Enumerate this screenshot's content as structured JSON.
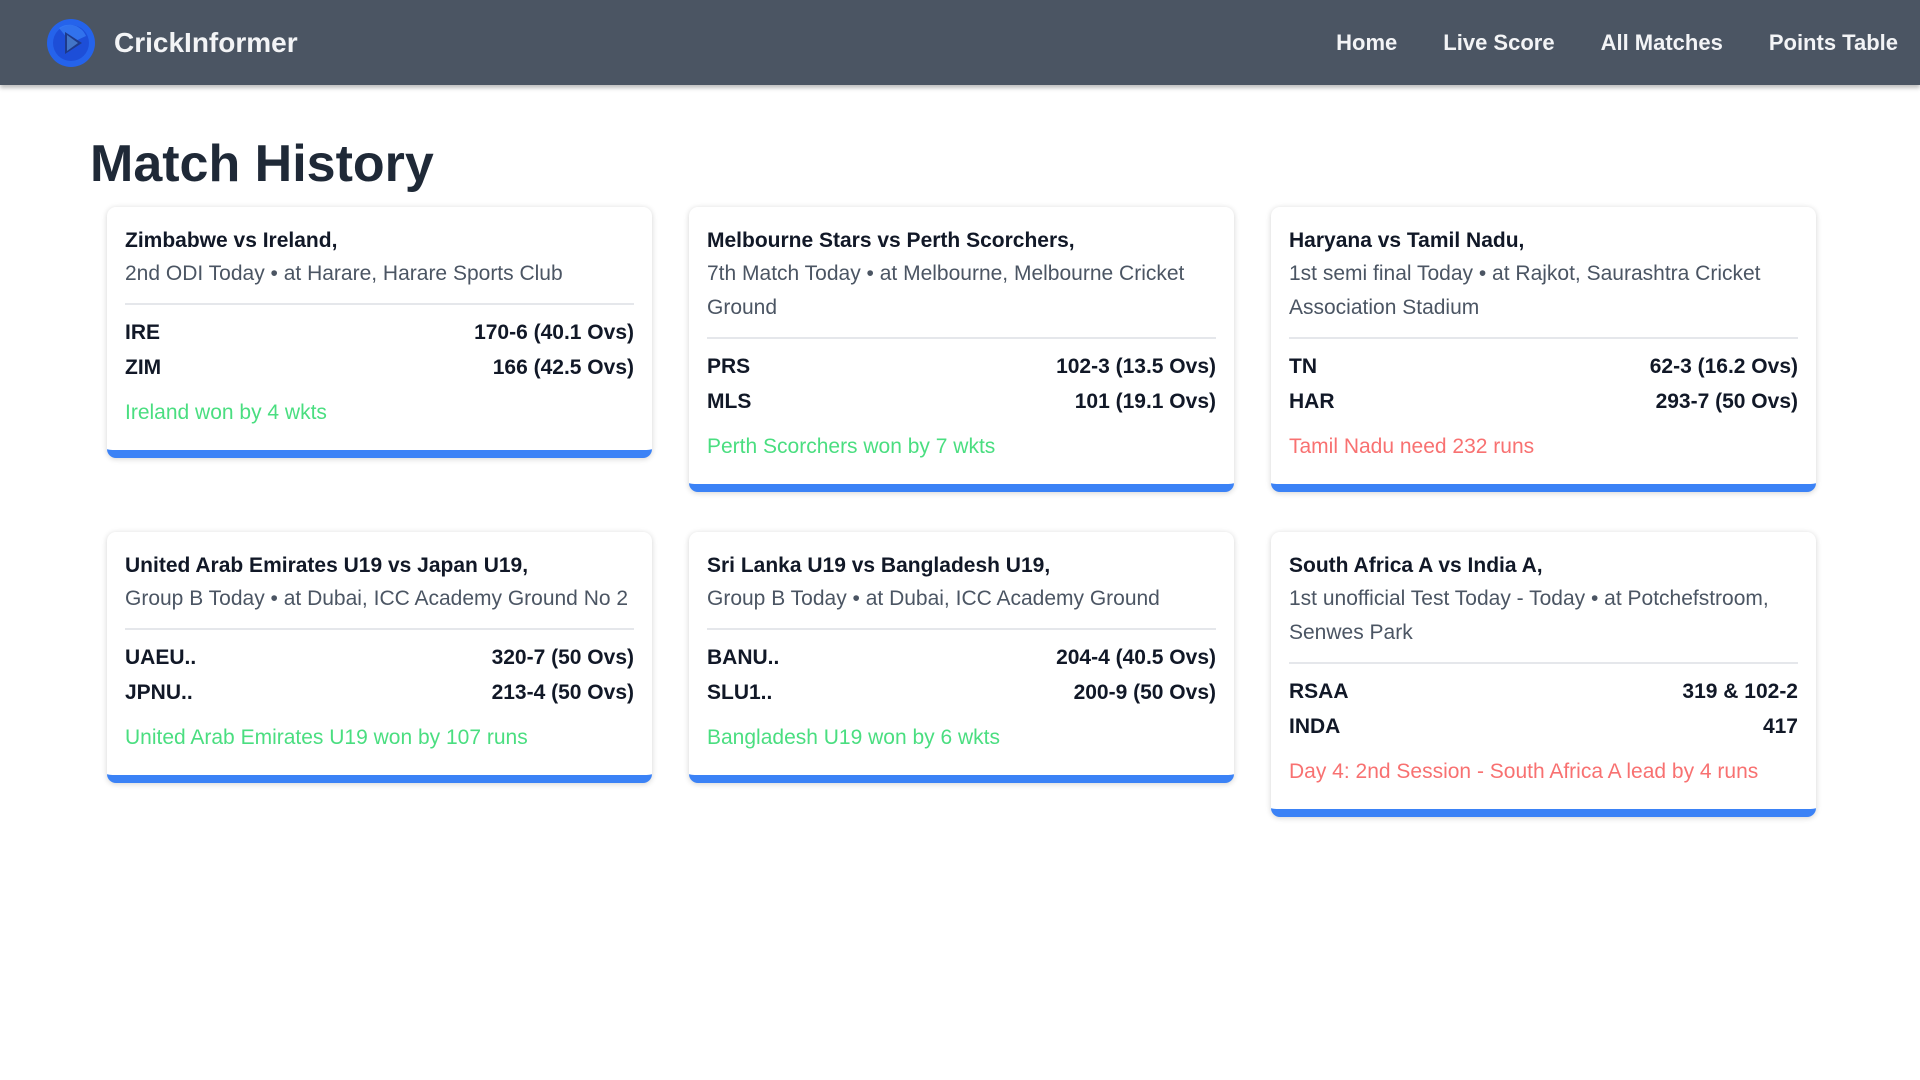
{
  "app": {
    "brand": "CrickInformer",
    "nav": [
      {
        "label": "Home"
      },
      {
        "label": "Live Score"
      },
      {
        "label": "All Matches"
      },
      {
        "label": "Points Table"
      }
    ]
  },
  "page": {
    "title": "Match History"
  },
  "colors": {
    "navbar": "#4b5563",
    "accent": "#3b82f6",
    "result_complete": "#4ade80",
    "result_live": "#f87171"
  },
  "matches": [
    {
      "title": "Zimbabwe vs Ireland,",
      "subtitle": "2nd ODI Today • at Harare, Harare Sports Club",
      "teams": [
        {
          "name": "IRE",
          "score": "170-6 (40.1 Ovs)"
        },
        {
          "name": "ZIM",
          "score": "166 (42.5 Ovs)"
        }
      ],
      "status": "Ireland won by 4 wkts",
      "status_type": "complete"
    },
    {
      "title": "Melbourne Stars vs Perth Scorchers,",
      "subtitle": "7th Match Today • at Melbourne, Melbourne Cricket Ground",
      "teams": [
        {
          "name": "PRS",
          "score": "102-3 (13.5 Ovs)"
        },
        {
          "name": "MLS",
          "score": "101 (19.1 Ovs)"
        }
      ],
      "status": "Perth Scorchers won by 7 wkts",
      "status_type": "complete"
    },
    {
      "title": "Haryana vs Tamil Nadu,",
      "subtitle": "1st semi final Today • at Rajkot, Saurashtra Cricket Association Stadium",
      "teams": [
        {
          "name": "TN",
          "score": "62-3 (16.2 Ovs)"
        },
        {
          "name": "HAR",
          "score": "293-7 (50 Ovs)"
        }
      ],
      "status": "Tamil Nadu need 232 runs",
      "status_type": "live"
    },
    {
      "title": "United Arab Emirates U19 vs Japan U19,",
      "subtitle": "Group B Today • at Dubai, ICC Academy Ground No 2",
      "teams": [
        {
          "name": "UAEU..",
          "score": "320-7 (50 Ovs)"
        },
        {
          "name": "JPNU..",
          "score": "213-4 (50 Ovs)"
        }
      ],
      "status": "United Arab Emirates U19 won by 107 runs",
      "status_type": "complete"
    },
    {
      "title": "Sri Lanka U19 vs Bangladesh U19,",
      "subtitle": "Group B Today • at Dubai, ICC Academy Ground",
      "teams": [
        {
          "name": "BANU..",
          "score": "204-4 (40.5 Ovs)"
        },
        {
          "name": "SLU1..",
          "score": "200-9 (50 Ovs)"
        }
      ],
      "status": "Bangladesh U19 won by 6 wkts",
      "status_type": "complete"
    },
    {
      "title": "South Africa A vs India A,",
      "subtitle": "1st unofficial Test Today - Today • at Potchefstroom, Senwes Park",
      "teams": [
        {
          "name": "RSAA",
          "score": "319 & 102-2"
        },
        {
          "name": "INDA",
          "score": "417"
        }
      ],
      "status": "Day 4: 2nd Session - South Africa A lead by 4 runs",
      "status_type": "live"
    }
  ]
}
